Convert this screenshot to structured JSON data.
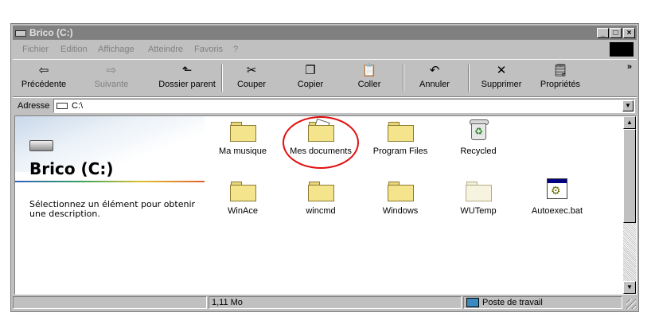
{
  "window": {
    "title": "Brico (C:)",
    "controls": {
      "minimize": "_",
      "maximize": "□",
      "close": "×"
    }
  },
  "menubar": {
    "items": [
      "Fichier",
      "Edition",
      "Affichage",
      "Atteindre",
      "Favoris",
      "?"
    ]
  },
  "toolbar": {
    "buttons": [
      {
        "label": "Précédente",
        "icon": "back-arrow-icon",
        "glyph": "⇦"
      },
      {
        "label": "Suivante",
        "icon": "forward-arrow-icon",
        "glyph": "⇨"
      },
      {
        "label": "Dossier parent",
        "icon": "up-folder-icon",
        "glyph": "⬑"
      },
      {
        "label": "Couper",
        "icon": "scissors-icon",
        "glyph": "✂"
      },
      {
        "label": "Copier",
        "icon": "copy-icon",
        "glyph": "❐"
      },
      {
        "label": "Coller",
        "icon": "paste-icon",
        "glyph": "📋"
      },
      {
        "label": "Annuler",
        "icon": "undo-icon",
        "glyph": "↶"
      },
      {
        "label": "Supprimer",
        "icon": "delete-x-icon",
        "glyph": "✕"
      },
      {
        "label": "Propriétés",
        "icon": "properties-icon",
        "glyph": "🗒"
      }
    ],
    "more": "»"
  },
  "address": {
    "label": "Adresse",
    "value": "C:\\"
  },
  "leftpane": {
    "drive_title": "Brico (C:)",
    "description": "Sélectionnez un élément pour obtenir une description."
  },
  "files": [
    {
      "name": "Ma musique",
      "kind": "folder"
    },
    {
      "name": "Mes documents",
      "kind": "folder-open"
    },
    {
      "name": "Program Files",
      "kind": "folder"
    },
    {
      "name": "Recycled",
      "kind": "recycle-bin"
    },
    {
      "name": "WinAce",
      "kind": "folder"
    },
    {
      "name": "wincmd",
      "kind": "folder"
    },
    {
      "name": "Windows",
      "kind": "folder"
    },
    {
      "name": "WUTemp",
      "kind": "folder-pale"
    },
    {
      "name": "Autoexec.bat",
      "kind": "batch-file"
    }
  ],
  "status": {
    "left": "",
    "size": "1,11 Mo",
    "zone": "Poste de travail"
  },
  "colors": {
    "titlebar": "#808080",
    "face": "#c0c0c0",
    "highlight_circle": "#e01010"
  }
}
